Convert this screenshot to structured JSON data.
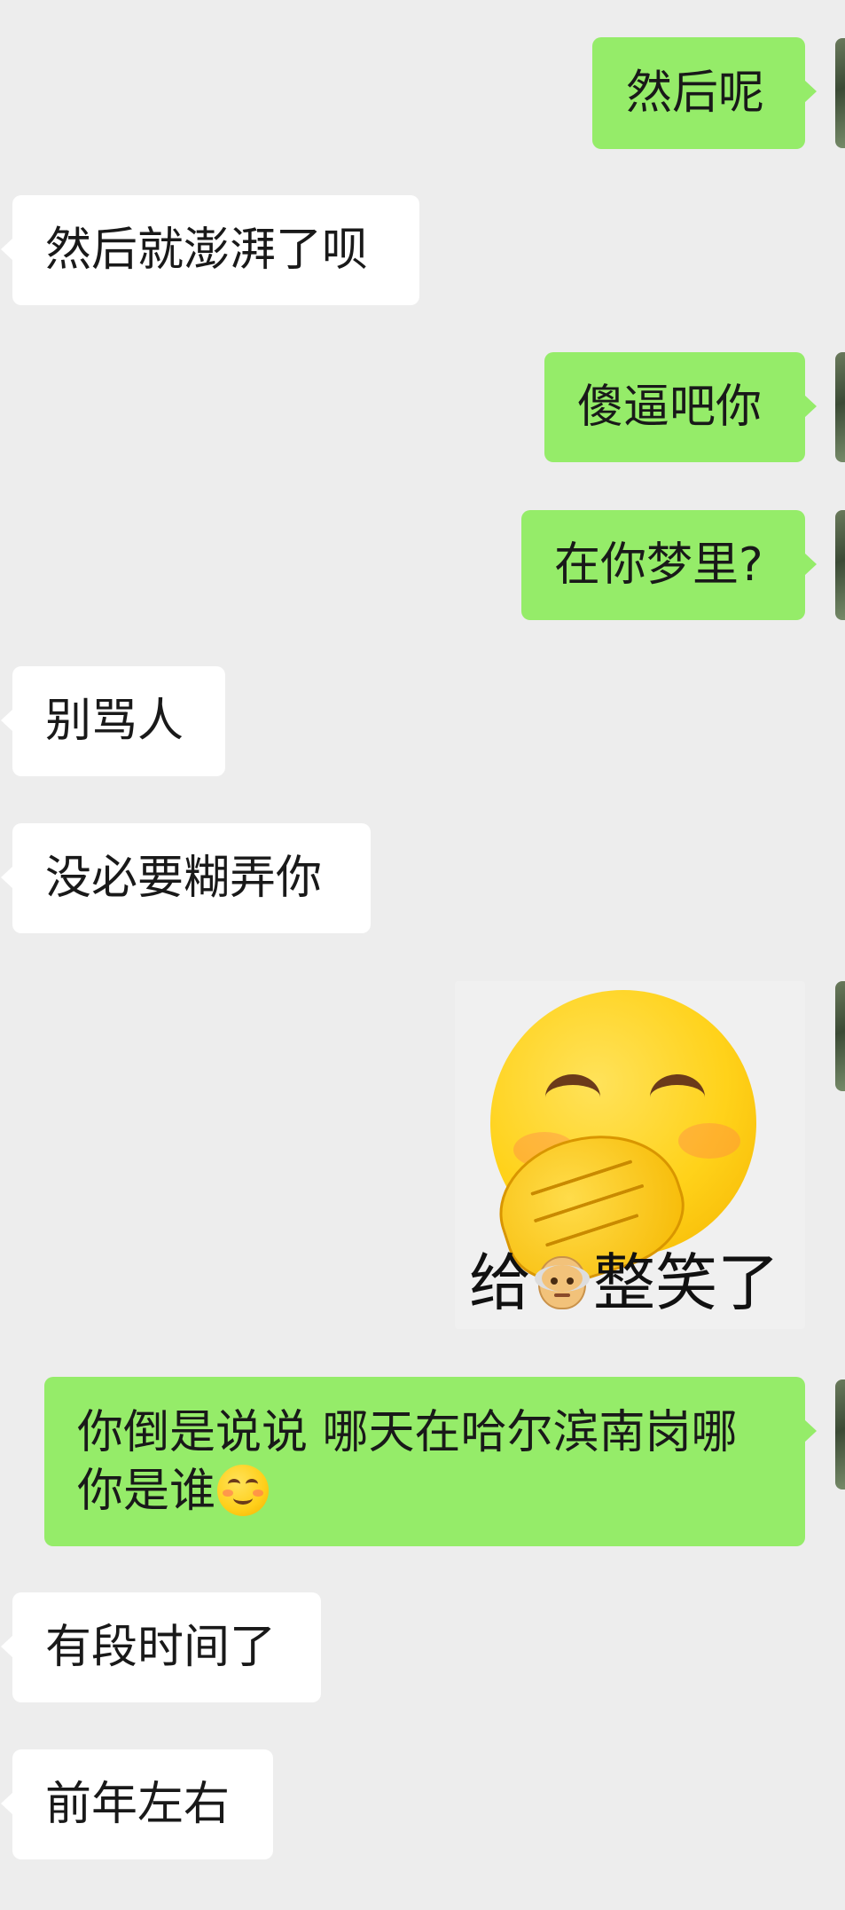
{
  "chat": {
    "messages": [
      {
        "id": "m1",
        "side": "out",
        "text": "然后呢"
      },
      {
        "id": "m2",
        "side": "in",
        "text": "然后就澎湃了呗"
      },
      {
        "id": "m3",
        "side": "out",
        "text": "傻逼吧你"
      },
      {
        "id": "m4",
        "side": "out",
        "text": "在你梦里?"
      },
      {
        "id": "m5",
        "side": "in",
        "text": "别骂人"
      },
      {
        "id": "m6",
        "side": "in",
        "text": "没必要糊弄你"
      },
      {
        "id": "m7",
        "side": "out",
        "type": "sticker",
        "sticker_text_before": "给",
        "sticker_icon": "older-man-emoji",
        "sticker_text_after": "整笑了",
        "sticker_face": "face-with-hand-over-mouth-emoji"
      },
      {
        "id": "m8",
        "side": "out",
        "line1": "你倒是说说 哪天在哈尔滨南岗哪",
        "line2": "你是谁",
        "trailing_icon": "smiling-face-with-smiling-eyes-emoji"
      },
      {
        "id": "m9",
        "side": "in",
        "text": "有段时间了"
      },
      {
        "id": "m10",
        "side": "in",
        "text": "前年左右"
      }
    ]
  },
  "colors": {
    "background": "#ededed",
    "incoming_bubble": "#ffffff",
    "outgoing_bubble": "#95ec69",
    "text": "#191919"
  }
}
